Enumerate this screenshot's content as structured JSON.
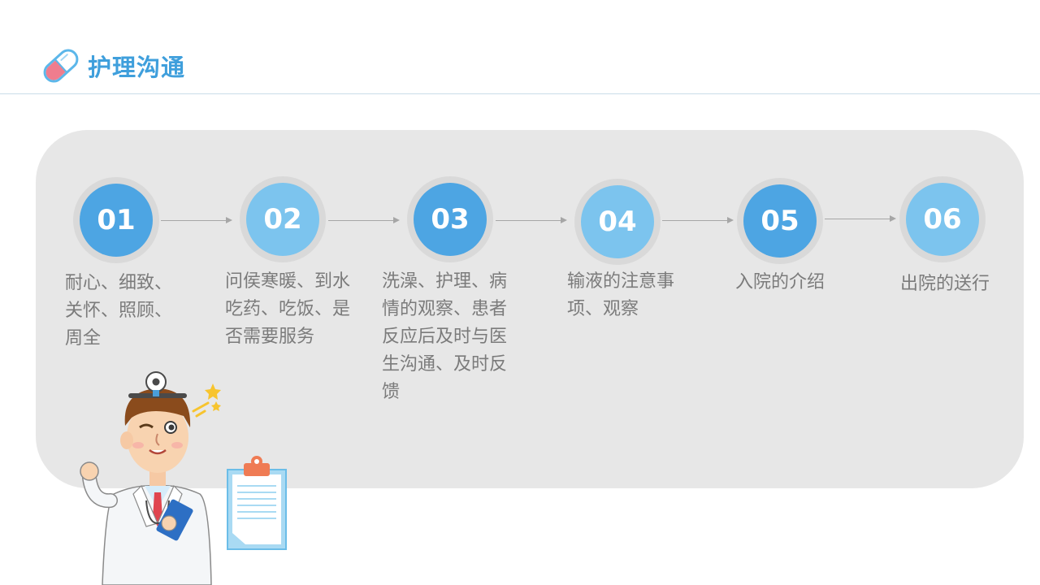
{
  "header": {
    "title": "护理沟通",
    "icon": "pill-capsule-icon",
    "accent_color": "#3f9fdc"
  },
  "steps": [
    {
      "number": "01",
      "text": "耐心、细致、关怀、照顾、周全",
      "color": "#4da5e3"
    },
    {
      "number": "02",
      "text": "问侯寒暖、到水吃药、吃饭、是否需要服务",
      "color": "#7cc4ee"
    },
    {
      "number": "03",
      "text": "洗澡、护理、病情的观察、患者反应后及时与医生沟通、及时反馈",
      "color": "#4da5e3"
    },
    {
      "number": "04",
      "text": "输液的注意事项、观察",
      "color": "#7cc4ee"
    },
    {
      "number": "05",
      "text": "入院的介绍",
      "color": "#4da5e3"
    },
    {
      "number": "06",
      "text": "出院的送行",
      "color": "#7cc4ee"
    }
  ],
  "illustration": {
    "doctor": "doctor-illustration",
    "clipboard": "clipboard-illustration"
  }
}
